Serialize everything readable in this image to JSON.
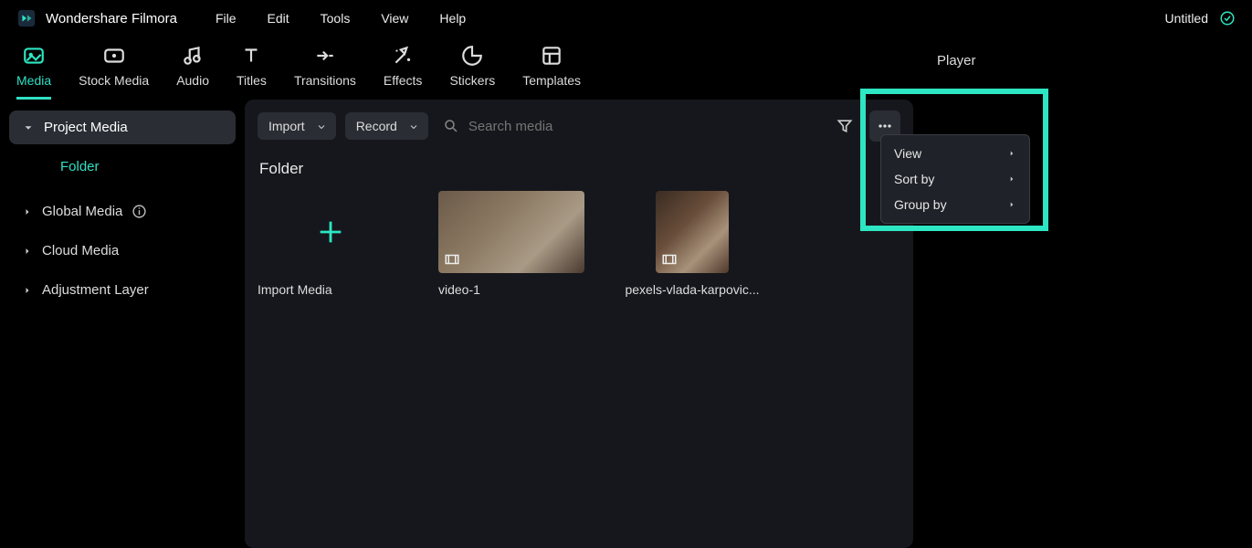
{
  "app": {
    "name": "Wondershare Filmora",
    "project_title": "Untitled"
  },
  "menubar": [
    "File",
    "Edit",
    "Tools",
    "View",
    "Help"
  ],
  "tabs": [
    {
      "id": "media",
      "label": "Media",
      "active": true
    },
    {
      "id": "stock",
      "label": "Stock Media"
    },
    {
      "id": "audio",
      "label": "Audio"
    },
    {
      "id": "titles",
      "label": "Titles"
    },
    {
      "id": "transitions",
      "label": "Transitions"
    },
    {
      "id": "effects",
      "label": "Effects"
    },
    {
      "id": "stickers",
      "label": "Stickers"
    },
    {
      "id": "templates",
      "label": "Templates"
    }
  ],
  "sidebar": {
    "project_media": "Project Media",
    "folder": "Folder",
    "global_media": "Global Media",
    "cloud_media": "Cloud Media",
    "adjustment_layer": "Adjustment Layer"
  },
  "toolbar": {
    "import": "Import",
    "record": "Record",
    "search_placeholder": "Search media"
  },
  "section": {
    "folder": "Folder"
  },
  "thumbs": {
    "import_media": "Import Media",
    "video1": "video-1",
    "video2": "pexels-vlada-karpovic..."
  },
  "context_menu": [
    "View",
    "Sort by",
    "Group by"
  ],
  "player": {
    "label": "Player"
  }
}
